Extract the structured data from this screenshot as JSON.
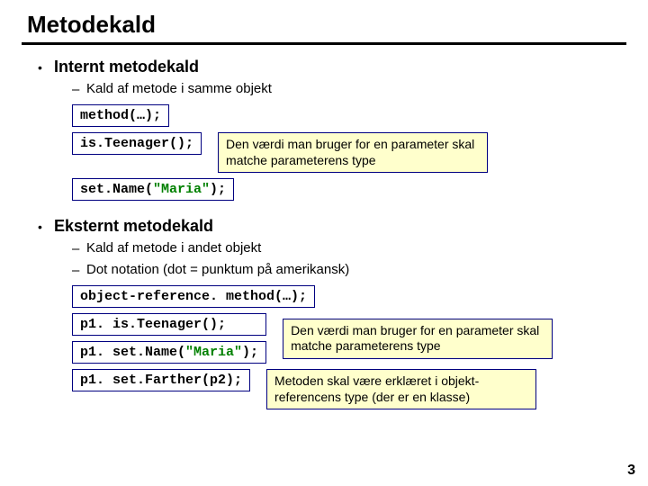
{
  "title": "Metodekald",
  "sec_internal": {
    "heading": "Internt metodekald",
    "sub1": "Kald af metode i samme objekt",
    "code_generic": "method(…);",
    "code_isteen": "is.Teenager();",
    "code_setname_pre": "set.Name(",
    "code_setname_str": "\"Maria\"",
    "code_setname_post": ");",
    "callout_param": "Den værdi man bruger for en parameter skal matche parameterens type"
  },
  "sec_external": {
    "heading": "Eksternt metodekald",
    "sub1": "Kald af metode i andet objekt",
    "sub2": "Dot notation (dot = punktum på amerikansk)",
    "code_generic": "object-reference. method(…);",
    "code_p1_isteen": "p1. is.Teenager();",
    "code_p1_setname_pre": "p1. set.Name(",
    "code_p1_setname_str": "\"Maria\"",
    "code_p1_setname_post": ");",
    "code_p1_setfather": "p1. set.Farther(p2);",
    "callout_param": "Den værdi man bruger for en parameter skal matche parameterens type",
    "callout_decl": "Metoden skal være erklæret i objekt-referencens type (der er en klasse)"
  },
  "page_number": "3"
}
